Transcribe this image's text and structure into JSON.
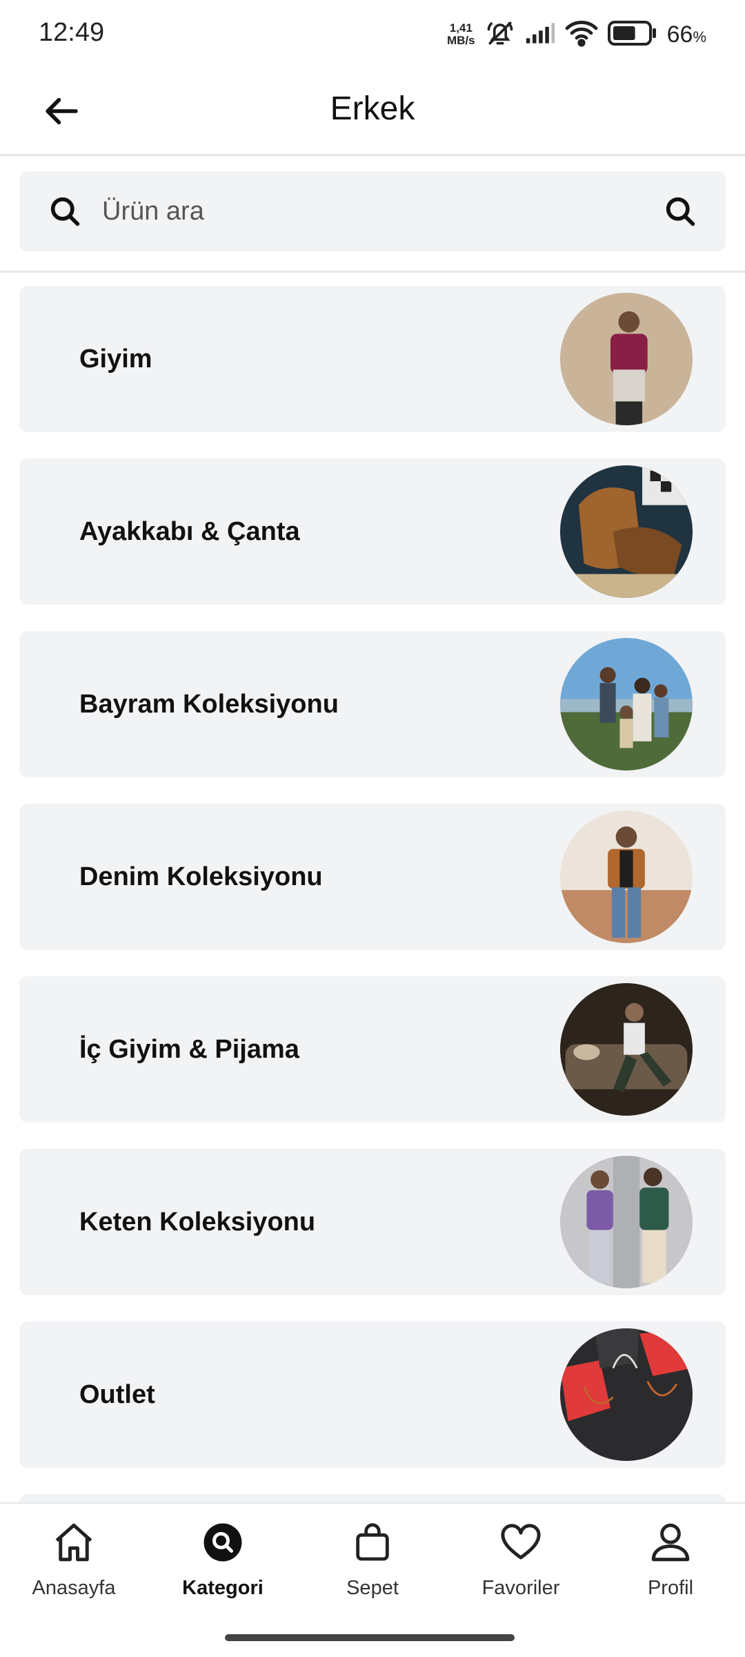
{
  "status_bar": {
    "time": "12:49",
    "net_speed_value": "1,41",
    "net_speed_unit": "MB/s",
    "battery_percent": "66",
    "battery_unit": "%",
    "battery_level": 0.66,
    "icons": [
      "mute-icon",
      "signal-icon",
      "wifi-icon",
      "battery-icon"
    ]
  },
  "header": {
    "title": "Erkek",
    "back_icon": "arrow-left-icon"
  },
  "search": {
    "placeholder": "Ürün ara",
    "value": ""
  },
  "categories": [
    {
      "label": "Giyim",
      "thumb_colors": [
        "#c9b49a",
        "#8a1f45"
      ]
    },
    {
      "label": "Ayakkabı & Çanta",
      "thumb_colors": [
        "#3b2a1e",
        "#a0642e"
      ]
    },
    {
      "label": "Bayram Koleksiyonu",
      "thumb_colors": [
        "#6fa8d6",
        "#4f6b3a"
      ]
    },
    {
      "label": "Denim Koleksiyonu",
      "thumb_colors": [
        "#e8ddd2",
        "#b0682f"
      ]
    },
    {
      "label": "İç Giyim & Pijama",
      "thumb_colors": [
        "#2d241c",
        "#6b5a48"
      ]
    },
    {
      "label": "Keten Koleksiyonu",
      "thumb_colors": [
        "#c7c7c9",
        "#7b5aa6"
      ]
    },
    {
      "label": "Outlet",
      "thumb_colors": [
        "#2b2b2d",
        "#e03a3a"
      ]
    }
  ],
  "bottom_nav": {
    "items": [
      {
        "label": "Anasayfa",
        "icon": "home-icon",
        "active": false
      },
      {
        "label": "Kategori",
        "icon": "category-search-icon",
        "active": true
      },
      {
        "label": "Sepet",
        "icon": "shopping-bag-icon",
        "active": false
      },
      {
        "label": "Favoriler",
        "icon": "heart-icon",
        "active": false
      },
      {
        "label": "Profil",
        "icon": "user-icon",
        "active": false
      }
    ]
  },
  "colors": {
    "card_bg": "#f2f3f5",
    "divider": "#e6e7ea",
    "text": "#111111"
  }
}
